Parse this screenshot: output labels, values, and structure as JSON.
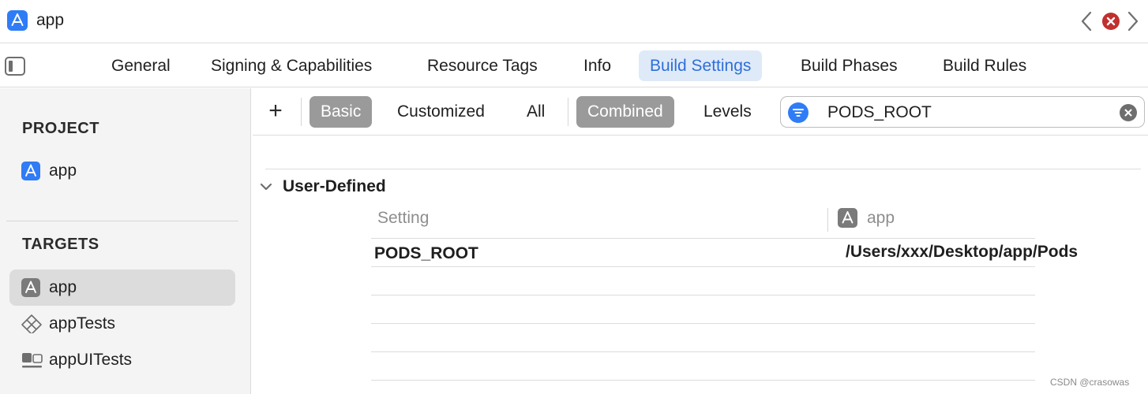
{
  "window": {
    "title": "app",
    "title_icon": "app-store-icon",
    "nav_icons": [
      "chevron-left-icon",
      "error-icon",
      "chevron-right-icon"
    ]
  },
  "tabs": [
    {
      "label": "General",
      "active": false
    },
    {
      "label": "Signing & Capabilities",
      "active": false
    },
    {
      "label": "Resource Tags",
      "active": false
    },
    {
      "label": "Info",
      "active": false
    },
    {
      "label": "Build Settings",
      "active": true
    },
    {
      "label": "Build Phases",
      "active": false
    },
    {
      "label": "Build Rules",
      "active": false
    }
  ],
  "sidebar": {
    "project_header": "PROJECT",
    "project_items": [
      {
        "label": "app",
        "icon": "app-store-icon"
      }
    ],
    "targets_header": "TARGETS",
    "target_items": [
      {
        "label": "app",
        "icon": "app-target-icon",
        "selected": true
      },
      {
        "label": "appTests",
        "icon": "unit-test-icon",
        "selected": false
      },
      {
        "label": "appUITests",
        "icon": "ui-test-icon",
        "selected": false
      }
    ]
  },
  "filterbar": {
    "add_label": "+",
    "scope_options": [
      {
        "label": "Basic",
        "selected": true
      },
      {
        "label": "Customized",
        "selected": false
      },
      {
        "label": "All",
        "selected": false
      }
    ],
    "view_options": [
      {
        "label": "Combined",
        "selected": true
      },
      {
        "label": "Levels",
        "selected": false
      }
    ],
    "search_value": "PODS_ROOT"
  },
  "settings": {
    "group_title": "User-Defined",
    "col_setting": "Setting",
    "col_target": "app",
    "rows": [
      {
        "name": "PODS_ROOT",
        "value": "/Users/xxx/Desktop/app/Pods"
      }
    ]
  },
  "watermark": "CSDN @crasowas",
  "colors": {
    "accent": "#2f7cf6",
    "active_tab_bg": "#dfeaf8",
    "active_tab_text": "#2e6fd8",
    "segment_on": "#9a9a9a",
    "error": "#c0302e",
    "sidebar_bg": "#f4f4f4"
  }
}
